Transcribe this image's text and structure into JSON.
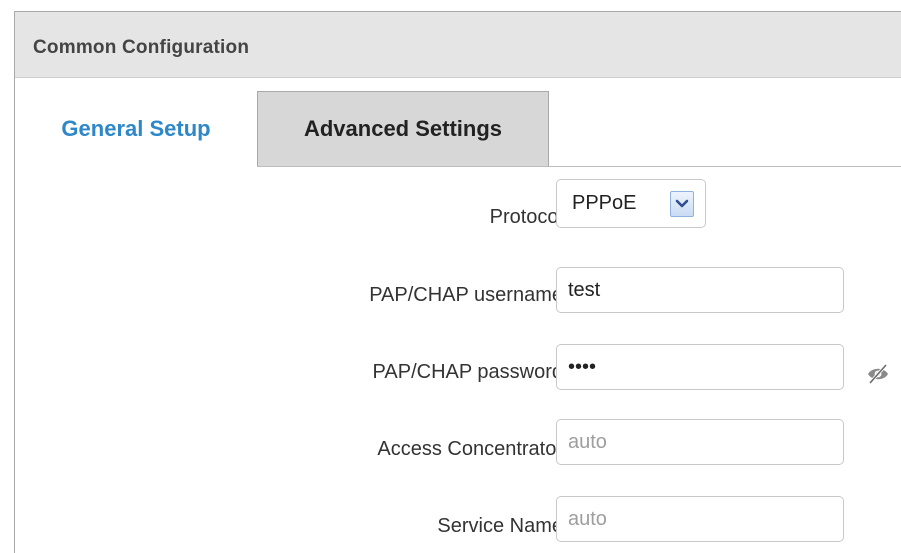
{
  "panel": {
    "title": "Common Configuration"
  },
  "tabs": [
    {
      "label": "General Setup",
      "active": true
    },
    {
      "label": "Advanced Settings",
      "active": false
    }
  ],
  "form": {
    "protocol": {
      "label": "Protocol",
      "value": "PPPoE"
    },
    "username": {
      "label": "PAP/CHAP username",
      "value": "test"
    },
    "password": {
      "label": "PAP/CHAP password",
      "value": "test",
      "reveal_icon": "eye-slash-icon"
    },
    "access_concentrator": {
      "label": "Access Concentrator",
      "placeholder": "auto"
    },
    "service_name": {
      "label": "Service Name",
      "placeholder": "auto"
    }
  },
  "colors": {
    "active_tab": "#2d87c9",
    "header_bg": "#e5e5e5",
    "inactive_tab_bg": "#d7d7d7"
  }
}
